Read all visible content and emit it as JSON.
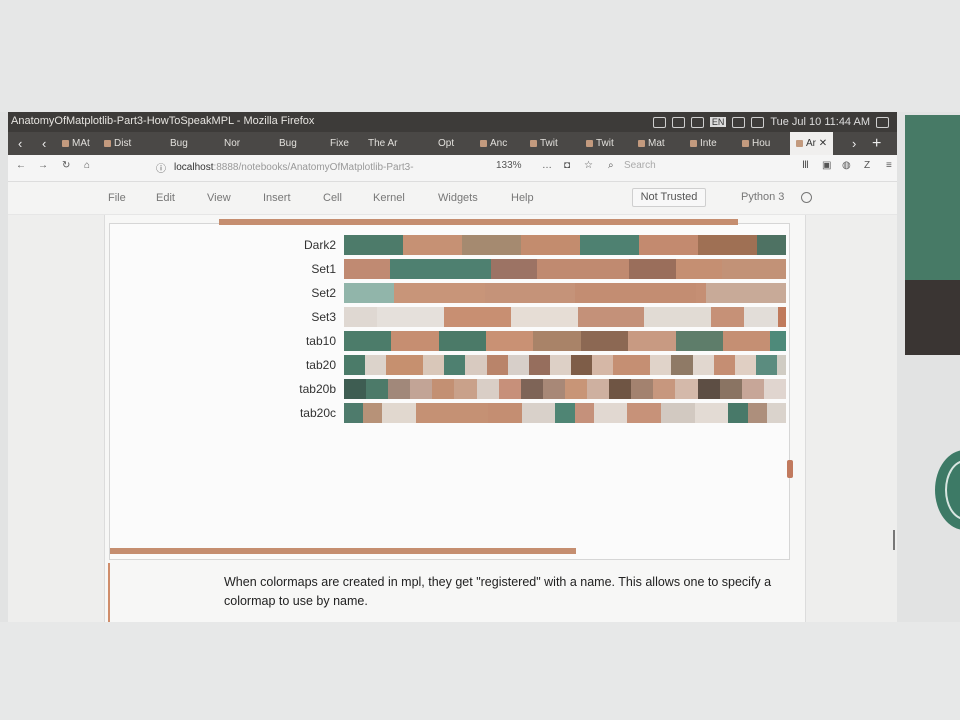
{
  "window": {
    "title": "AnatomyOfMatplotlib-Part3-HowToSpeakMPL - Mozilla Firefox"
  },
  "tray": {
    "clock": "Tue Jul 10 11:44 AM",
    "lang": "EN"
  },
  "tabs": [
    {
      "label": "MAt"
    },
    {
      "label": "Dist"
    },
    {
      "label": "Bug"
    },
    {
      "label": "Nor"
    },
    {
      "label": "Bug"
    },
    {
      "label": "Fixe"
    },
    {
      "label": "The Ar"
    },
    {
      "label": "Opt"
    },
    {
      "label": "Anc"
    },
    {
      "label": "Twit"
    },
    {
      "label": "Twit"
    },
    {
      "label": "Mat"
    },
    {
      "label": "Inte"
    },
    {
      "label": "Hou"
    },
    {
      "label": "Ar"
    }
  ],
  "nav": {
    "url_host": "localhost",
    "url_path": ":8888/notebooks/AnatomyOfMatplotlib-Part3-",
    "zoom": "133%",
    "search_placeholder": "Search"
  },
  "notebook": {
    "menu": [
      "File",
      "Edit",
      "View",
      "Insert",
      "Cell",
      "Kernel",
      "Widgets",
      "Help"
    ],
    "trust": "Not Trusted",
    "kernel": "Python 3"
  },
  "colormaps": [
    {
      "name": "Dark2",
      "colors": [
        "#4d7b6a",
        "#c69174",
        "#a58a70",
        "#c38c6e",
        "#4e8171",
        "#c38a6f",
        "#9f7054",
        "#4e7263"
      ],
      "weights": [
        6,
        6,
        6,
        6,
        6,
        6,
        6,
        3
      ]
    },
    {
      "name": "Set1",
      "colors": [
        "#c08a72",
        "#4e8070",
        "#9c7364",
        "#c08a70",
        "#9a6e5b",
        "#c58f72",
        "#c29277"
      ],
      "weights": [
        5,
        11,
        5,
        10,
        5,
        5,
        7
      ]
    },
    {
      "name": "Set2",
      "colors": [
        "#91b5aa",
        "#c89579",
        "#c59379",
        "#c38d72",
        "#c58f74",
        "#c8aa98"
      ],
      "weights": [
        5,
        9,
        9,
        12,
        1,
        8
      ]
    },
    {
      "name": "Set3",
      "colors": [
        "#dfd8d2",
        "#e5e0db",
        "#c88f72",
        "#e6ddd5",
        "#c49179",
        "#e1dbd4",
        "#c69177",
        "#e2ddd8",
        "#c07a5c"
      ],
      "weights": [
        4,
        8,
        8,
        8,
        8,
        8,
        4,
        4,
        1
      ]
    },
    {
      "name": "tab10",
      "colors": [
        "#4c7c6a",
        "#c68e71",
        "#4b7a68",
        "#c99174",
        "#a98368",
        "#8c6853",
        "#c89a82",
        "#5e7d6a",
        "#c58f73",
        "#4e8a7a"
      ],
      "weights": [
        4.5,
        4.5,
        4.5,
        4.5,
        4.5,
        4.5,
        4.5,
        4.5,
        4.5,
        1.5
      ]
    },
    {
      "name": "tab20",
      "colors": [
        "#4b7b69",
        "#dcd3cb",
        "#c6906f",
        "#d9c7b9",
        "#4e8070",
        "#d8cac0",
        "#b9846a",
        "#d7cfc9",
        "#966e5d",
        "#ddd0c6",
        "#7e5d48",
        "#d5b7a6",
        "#c58f73",
        "#e0d3c9",
        "#8f7a66",
        "#e1d7cf",
        "#c58e73",
        "#e0cfc3",
        "#5b8c7f",
        "#d0ccc3"
      ],
      "weights": [
        2.4,
        2.4,
        4.2,
        2.4,
        2.4,
        2.4,
        2.4,
        2.4,
        2.4,
        2.4,
        2.4,
        2.4,
        4.2,
        2.4,
        2.4,
        2.4,
        2.4,
        2.4,
        2.4,
        1
      ]
    },
    {
      "name": "tab20b",
      "colors": [
        "#3e5d52",
        "#4c7a69",
        "#a1887a",
        "#c2a496",
        "#c39073",
        "#c9a18a",
        "#d9cec6",
        "#c7907a",
        "#7e6457",
        "#a88877",
        "#c89577",
        "#ceb0a0",
        "#6f5544",
        "#a3826f",
        "#c7977e",
        "#d4b9aa",
        "#5d4e44",
        "#8a7463",
        "#c7a698",
        "#e0d5cf"
      ],
      "weights": [
        2.4,
        2.4,
        2.4,
        2.4,
        2.4,
        2.4,
        2.4,
        2.4,
        2.4,
        2.4,
        2.4,
        2.4,
        2.4,
        2.4,
        2.4,
        2.4,
        2.4,
        2.4,
        2.4,
        2.4
      ]
    },
    {
      "name": "tab20c",
      "colors": [
        "#4e7b6c",
        "#b79278",
        "#e1d8cf",
        "#c59174",
        "#c48e72",
        "#d9d1ca",
        "#4f8574",
        "#c5917b",
        "#e1d8d1",
        "#c79279",
        "#d2c9c1",
        "#e3dbd4",
        "#487969",
        "#ad8f7c",
        "#dad3cc"
      ],
      "weights": [
        2.4,
        2.4,
        4.2,
        9,
        4.2,
        4.2,
        2.4,
        2.4,
        4.2,
        4.2,
        4.2,
        4.2,
        2.4,
        2.4,
        2.4
      ]
    }
  ],
  "markdown": {
    "text": "When colormaps are created in mpl, they get \"registered\" with a name. This allows one to specify a colormap to use by name."
  }
}
